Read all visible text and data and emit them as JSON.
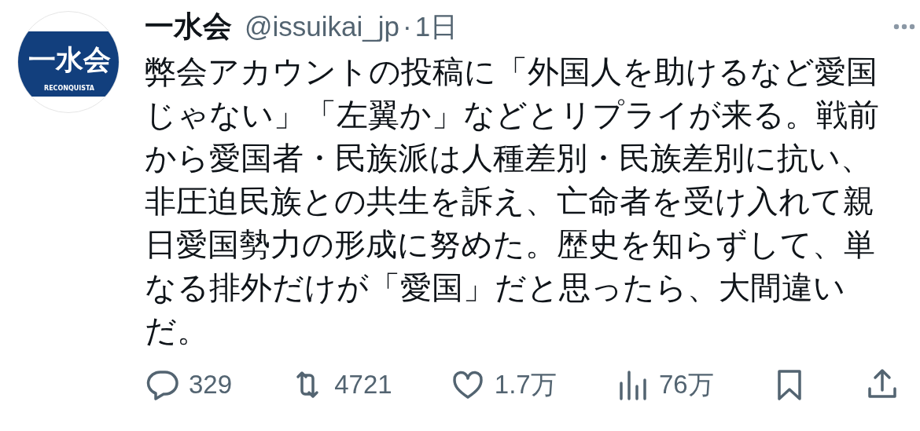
{
  "avatar": {
    "logo_text": "一水会",
    "logo_subtext": "RECONQUISTA"
  },
  "author": {
    "name": "一水会",
    "handle": "@issuikai_jp",
    "separator": "·",
    "time": "1日"
  },
  "body": "弊会アカウントの投稿に「外国人を助けるなど愛国じゃない」「左翼か」などとリプライが来る。戦前から愛国者・民族派は人種差別・民族差別に抗い、非圧迫民族との共生を訴え、亡命者を受け入れて親日愛国勢力の形成に努めた。歴史を知らずして、単なる排外だけが「愛国」だと思ったら、大間違いだ。",
  "actions": [
    {
      "kind": "reply",
      "count": "329"
    },
    {
      "kind": "repost",
      "count": "4721"
    },
    {
      "kind": "like",
      "count": "1.7万"
    },
    {
      "kind": "views",
      "count": "76万"
    },
    {
      "kind": "bookmark"
    },
    {
      "kind": "share"
    }
  ]
}
